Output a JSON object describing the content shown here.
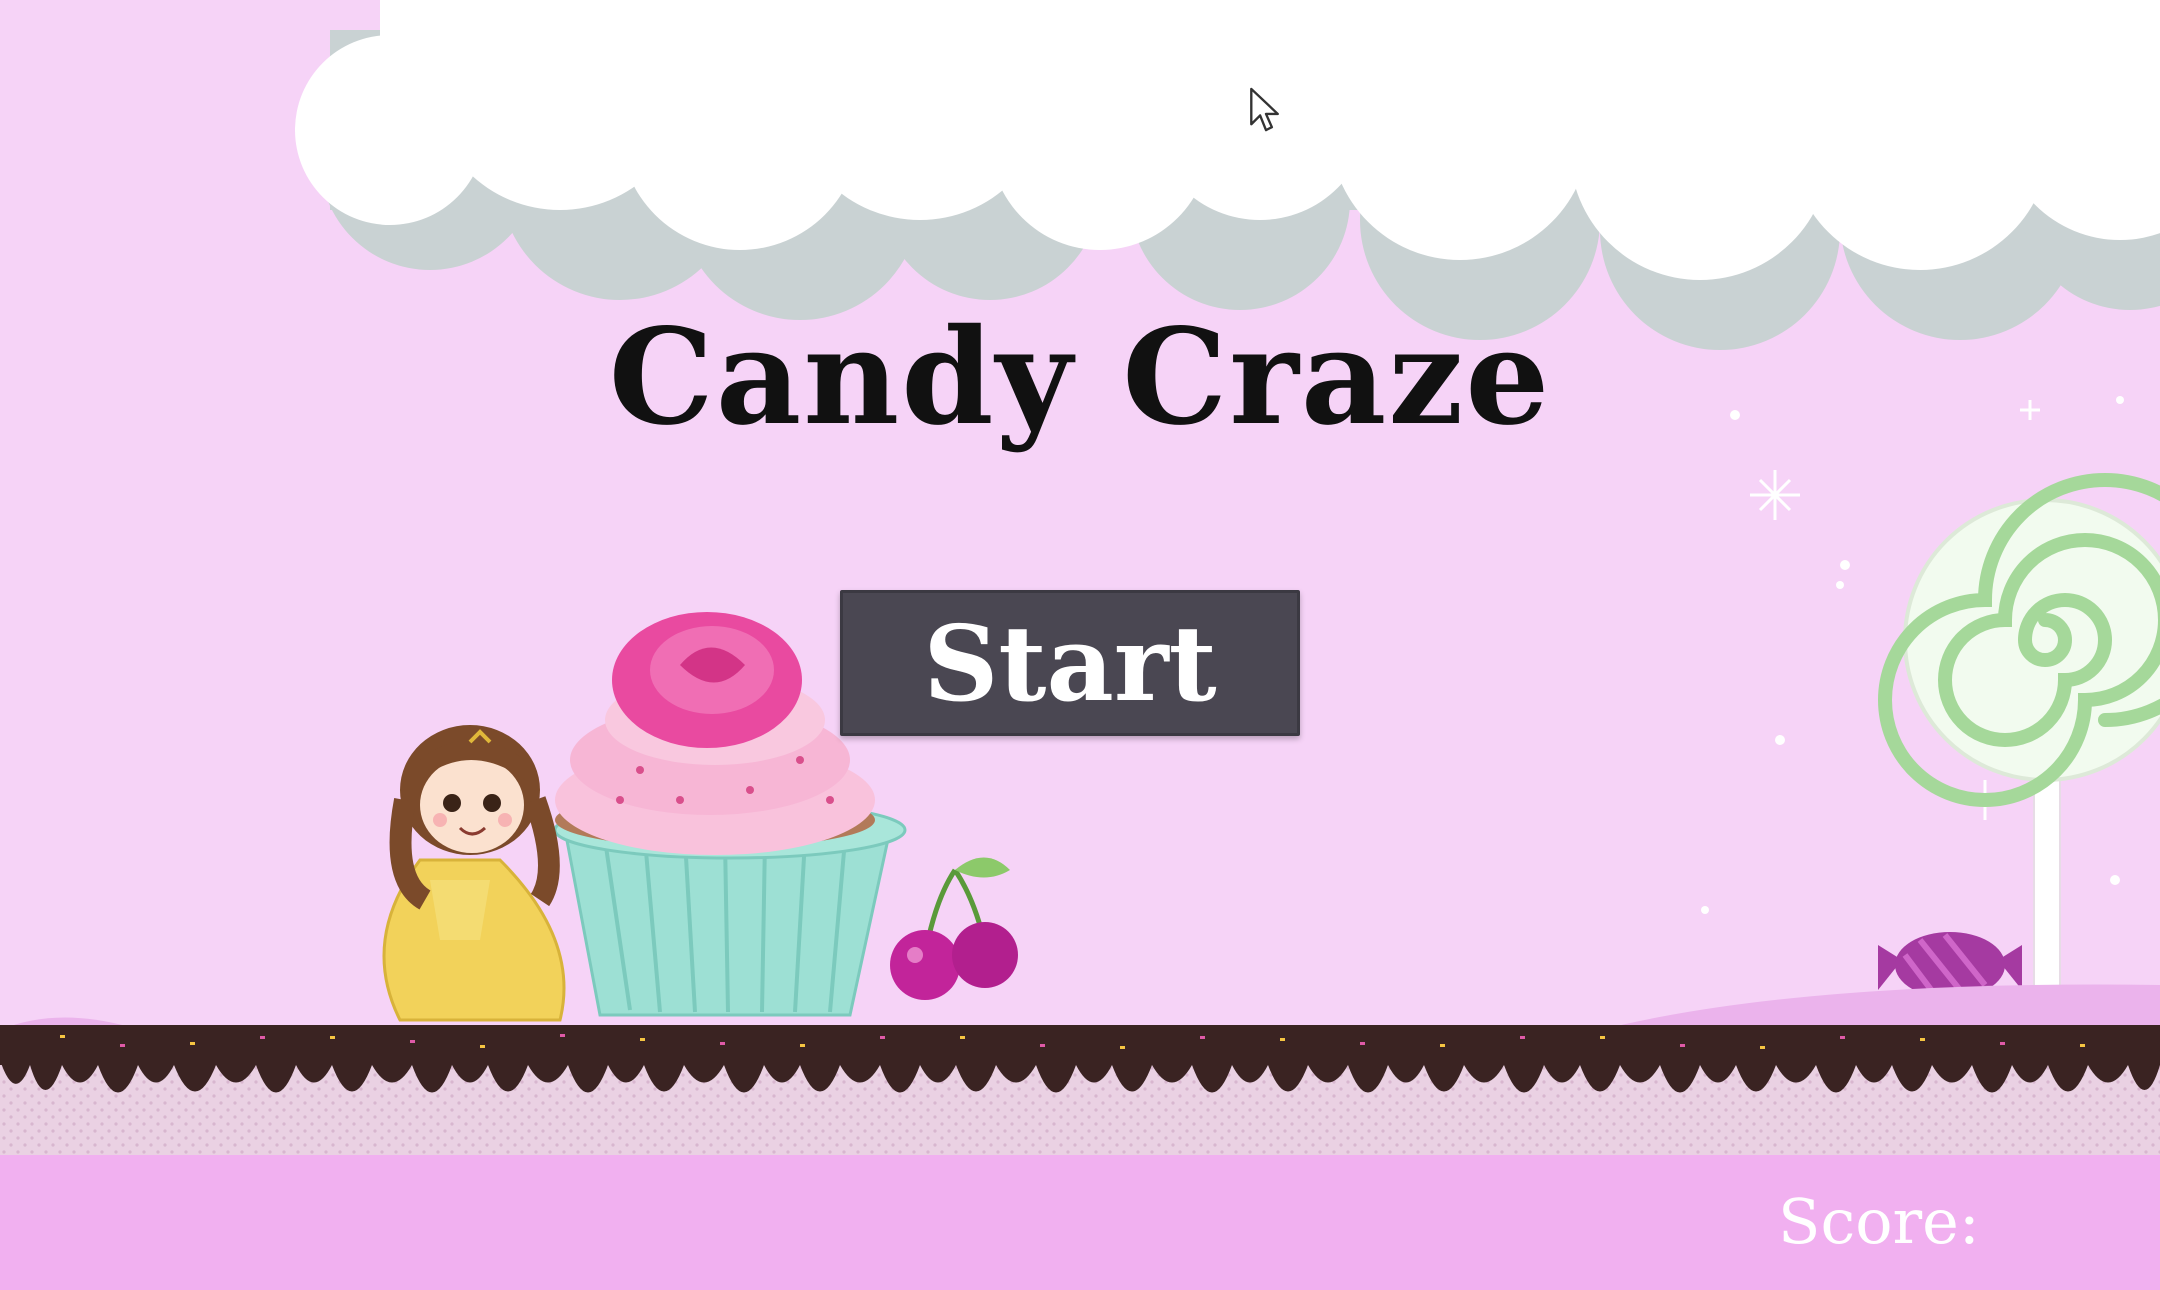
{
  "game": {
    "title": "Candy Craze",
    "start_label": "Start",
    "score_label": "Score:"
  },
  "colors": {
    "sky": "#f6d3f7",
    "ground_band": "#f1b0f0",
    "chocolate": "#3a2322",
    "button": "#4a4752",
    "cloud": "#ffffff",
    "cloud_shadow": "#c9d2d3"
  }
}
